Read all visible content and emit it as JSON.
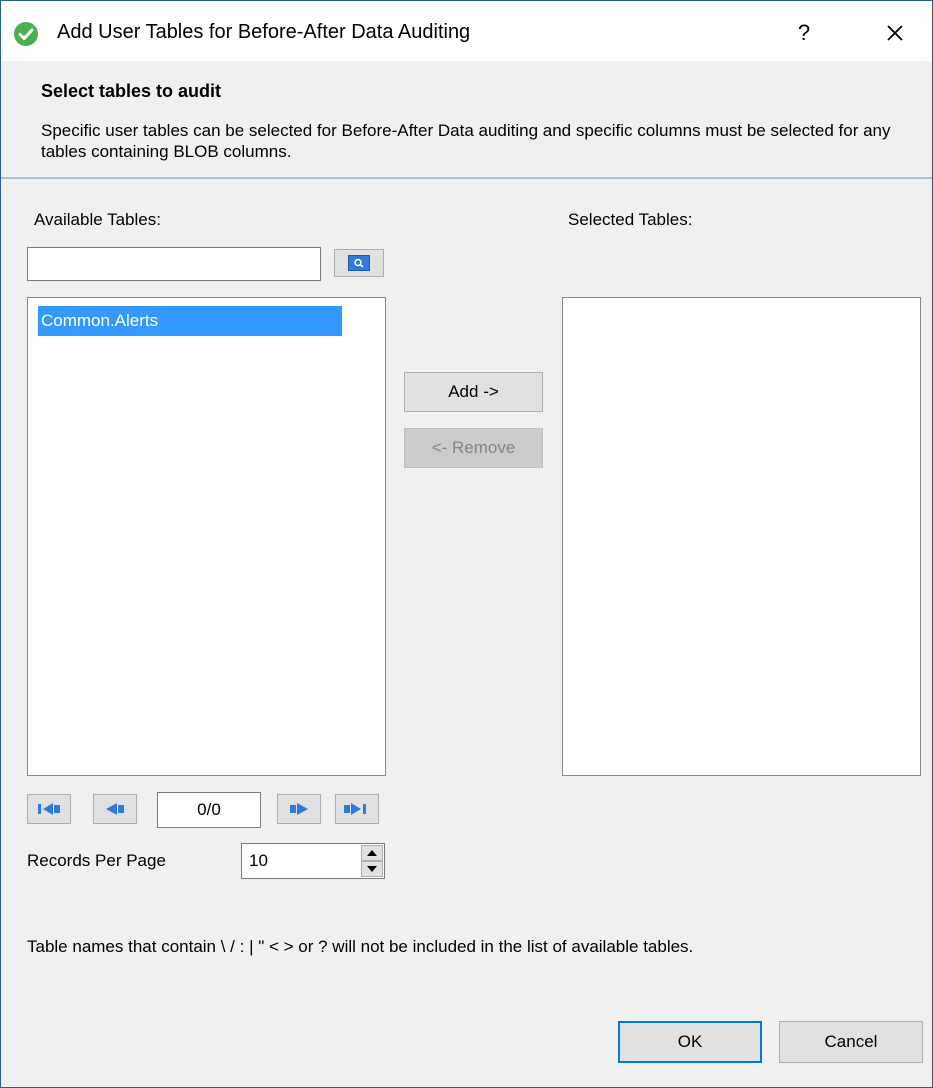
{
  "window": {
    "title": "Add User Tables for Before-After Data Auditing",
    "help_label": "?"
  },
  "header": {
    "title": "Select tables to audit",
    "description": "Specific user tables can be selected for Before-After Data auditing and specific columns must be selected for any tables containing BLOB columns."
  },
  "available": {
    "label": "Available Tables:",
    "search_value": "",
    "items": [
      "Common.Alerts"
    ]
  },
  "selected": {
    "label": "Selected Tables:",
    "items": []
  },
  "buttons": {
    "add": "Add ->",
    "remove": "<- Remove",
    "ok": "OK",
    "cancel": "Cancel"
  },
  "pager": {
    "page_indicator": "0/0",
    "records_label": "Records Per Page",
    "records_value": "10"
  },
  "note": "Table names that contain \\ / : | \" < > or ? will not be included in the list of available tables.",
  "colors": {
    "selection": "#3399ff",
    "title_icon": "#4caf50",
    "pager_icon": "#2e7ad6",
    "default_button_border": "#0078d7"
  }
}
